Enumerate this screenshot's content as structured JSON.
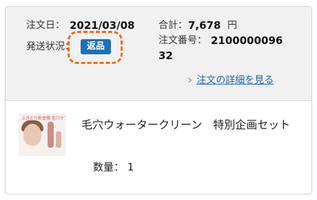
{
  "order": {
    "date_label": "注文日：",
    "date_value": "2021/03/08",
    "total_label": "合計：",
    "total_value": "7,678",
    "total_unit": "円",
    "number_label": "注文番号：",
    "number_value_line1": "2100000096",
    "number_value_line2": "32",
    "status_label": "発送状況：",
    "status_badge": "返品",
    "detail_link": "注文の詳細を見る"
  },
  "item": {
    "name": "毛穴ウォータークリーン　特別企画セット",
    "qty_label": "数量：",
    "qty_value": "1",
    "thumb_caption": "ふきとり新習慣 毛穴ケア"
  },
  "colors": {
    "badge_bg": "#1f6fb5",
    "highlight": "#ee6b1a",
    "link": "#1f63b0"
  }
}
